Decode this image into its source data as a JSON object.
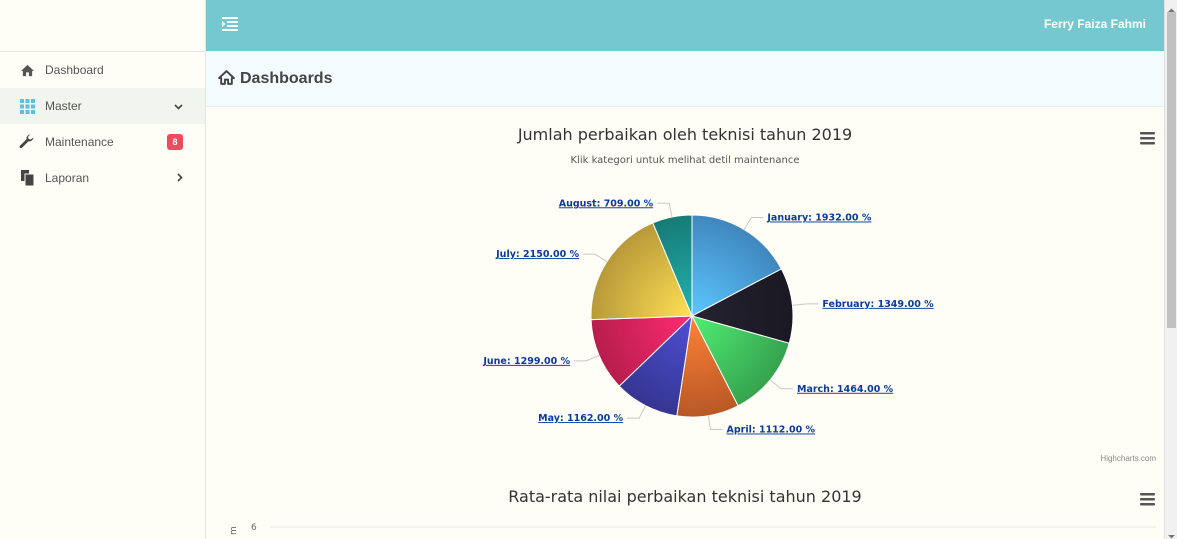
{
  "header": {
    "user_name": "Ferry Faiza Fahmi"
  },
  "sidebar": {
    "items": [
      {
        "label": "Dashboard",
        "icon": "home-icon"
      },
      {
        "label": "Master",
        "icon": "grid-icon"
      },
      {
        "label": "Maintenance",
        "icon": "wrench-icon",
        "badge": "8"
      },
      {
        "label": "Laporan",
        "icon": "files-icon"
      }
    ]
  },
  "page": {
    "title": "Dashboards"
  },
  "colors": {
    "topbar": "#74c9d1",
    "badge": "#f04a5d",
    "label_link": "#0b3aa0"
  },
  "chart_data": [
    {
      "type": "pie",
      "title": "Jumlah perbaikan oleh teknisi tahun 2019",
      "subtitle": "Klik kategori untuk melihat detil maintenance",
      "categories": [
        "January",
        "February",
        "March",
        "April",
        "May",
        "June",
        "July",
        "August"
      ],
      "values": [
        1932,
        1349,
        1464,
        1112,
        1162,
        1299,
        2150,
        709
      ],
      "labels": [
        "January: 1932.00 %",
        "February: 1349.00 %",
        "March: 1464.00 %",
        "April: 1112.00 %",
        "May: 1162.00 %",
        "June: 1299.00 %",
        "July: 2150.00 %",
        "August: 709.00 %"
      ],
      "colors": [
        "#4a9fe0",
        "#1e1c28",
        "#3fbf5c",
        "#d9682c",
        "#3e3fab",
        "#d7225a",
        "#d8b443",
        "#1b8f8a"
      ],
      "credits": "Highcharts.com"
    },
    {
      "type": "bar",
      "title": "Rata-rata nilai perbaikan teknisi tahun 2019",
      "ylabel": "m",
      "y_ticks": [
        "6"
      ]
    }
  ]
}
